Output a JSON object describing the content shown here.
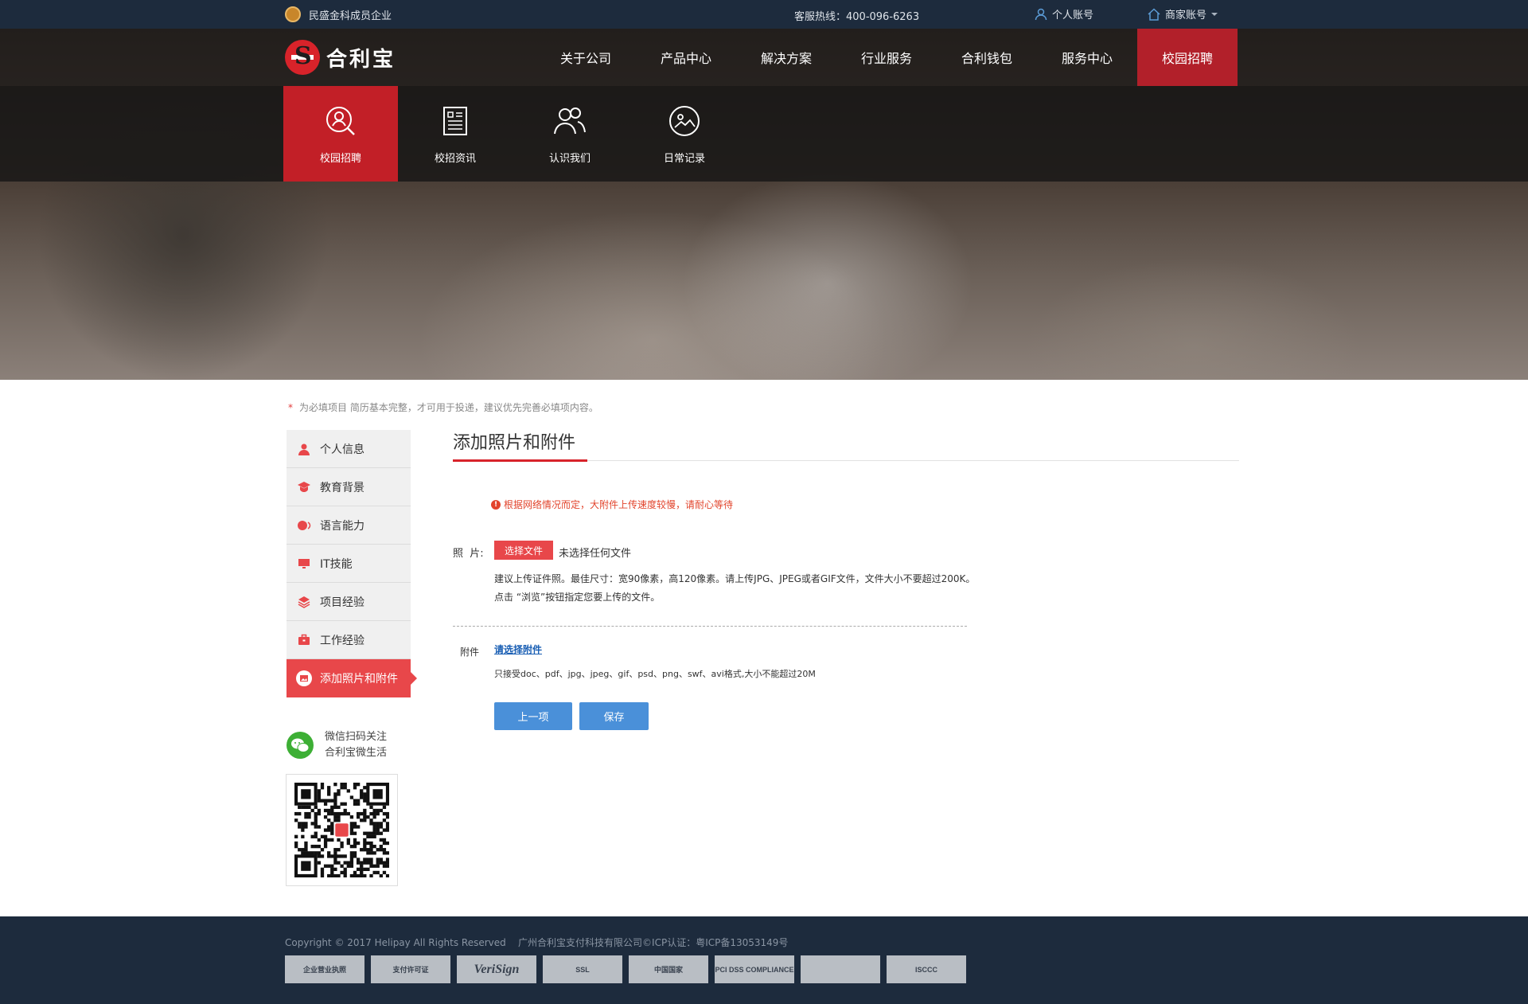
{
  "topbar": {
    "member_text": "民盛金科成员企业",
    "hotline": "客服热线：400-096-6263",
    "personal_account": "个人账号",
    "merchant_account": "商家账号"
  },
  "logo": {
    "text": "合利宝"
  },
  "main_nav": [
    {
      "label": "关于公司"
    },
    {
      "label": "产品中心"
    },
    {
      "label": "解决方案"
    },
    {
      "label": "行业服务"
    },
    {
      "label": "合利钱包"
    },
    {
      "label": "服务中心"
    },
    {
      "label": "校园招聘"
    }
  ],
  "sub_nav": [
    {
      "label": "校园招聘",
      "icon": "search-person-icon"
    },
    {
      "label": "校招资讯",
      "icon": "news-icon"
    },
    {
      "label": "认识我们",
      "icon": "people-icon"
    },
    {
      "label": "日常记录",
      "icon": "photo-icon"
    }
  ],
  "note": {
    "star": "*",
    "text": "为必填项目 简历基本完整，才可用于投递，建议优先完善必填项内容。"
  },
  "left_menu": [
    {
      "label": "个人信息",
      "icon": "user-icon"
    },
    {
      "label": "教育背景",
      "icon": "graduation-cap-icon"
    },
    {
      "label": "语言能力",
      "icon": "speech-icon"
    },
    {
      "label": "IT技能",
      "icon": "monitor-icon"
    },
    {
      "label": "项目经验",
      "icon": "layers-icon"
    },
    {
      "label": "工作经验",
      "icon": "briefcase-icon"
    },
    {
      "label": "添加照片和附件",
      "icon": "image-icon"
    }
  ],
  "wechat": {
    "line1": "微信扫码关注",
    "line2": "合利宝微生活"
  },
  "content": {
    "title": "添加照片和附件",
    "warning": "根据网络情况而定，大附件上传速度较慢，请耐心等待",
    "photo_label": "照  片:",
    "file_button": "选择文件",
    "no_file": "未选择任何文件",
    "photo_hint1": "建议上传证件照。最佳尺寸：宽90像素，高120像素。请上传JPG、JPEG或者GIF文件，文件大小不要超过200K。",
    "photo_hint2": "点击 “浏览”按钮指定您要上传的文件。",
    "attach_label": "附件",
    "attach_link": "请选择附件",
    "attach_hint": "只接受doc、pdf、jpg、jpeg、gif、psd、png、swf、avi格式,大小不能超过20M",
    "prev_button": "上一项",
    "save_button": "保存"
  },
  "footer": {
    "copyright": "Copyright © 2017 Helipay All Rights Reserved    广州合利宝支付科技有限公司©ICP认证：粤ICP备13053149号",
    "certs": [
      "企业营业执照",
      "支付许可证",
      "VeriSign",
      "SSL",
      "中国国家",
      "PCI DSS COMPLIANCE",
      "",
      "ISCCC"
    ]
  },
  "colors": {
    "accent_red": "#d8232a",
    "nav_dark": "#1d2b3d",
    "button_blue": "#4a90d9"
  }
}
